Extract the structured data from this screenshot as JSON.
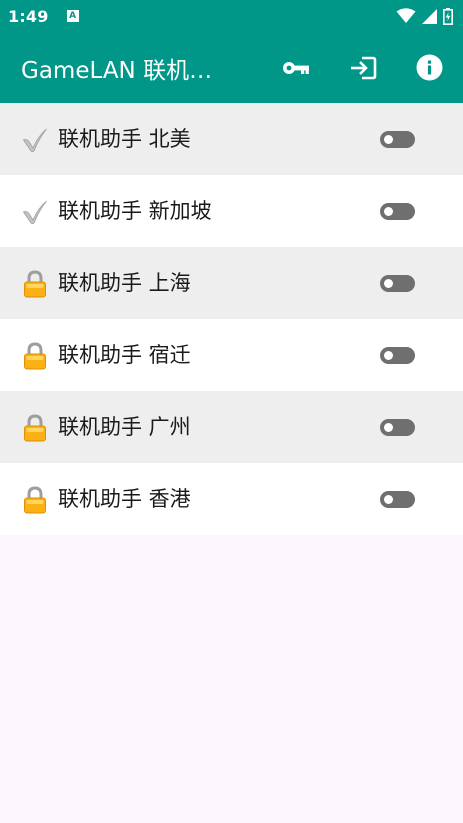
{
  "status_bar": {
    "time": "1:49",
    "notification_letter": "A",
    "icons": [
      "wifi-icon",
      "signal-icon",
      "battery-icon"
    ]
  },
  "app_bar": {
    "title": "GameLAN 联机助手",
    "actions": [
      "key-icon",
      "login-icon",
      "info-icon"
    ],
    "color": "#009688"
  },
  "servers": [
    {
      "label": "联机助手 北美",
      "status": "available",
      "icon": "check-icon",
      "enabled": false
    },
    {
      "label": "联机助手 新加坡",
      "status": "available",
      "icon": "check-icon",
      "enabled": false
    },
    {
      "label": "联机助手 上海",
      "status": "locked",
      "icon": "lock-icon",
      "enabled": false
    },
    {
      "label": "联机助手 宿迁",
      "status": "locked",
      "icon": "lock-icon",
      "enabled": false
    },
    {
      "label": "联机助手 广州",
      "status": "locked",
      "icon": "lock-icon",
      "enabled": false
    },
    {
      "label": "联机助手 香港",
      "status": "locked",
      "icon": "lock-icon",
      "enabled": false
    }
  ]
}
